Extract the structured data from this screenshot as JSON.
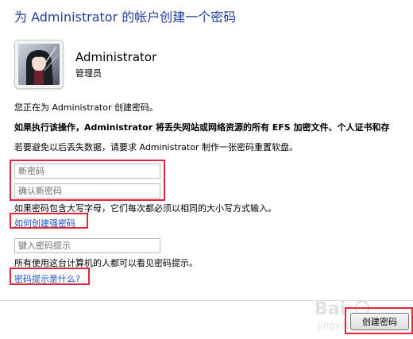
{
  "page": {
    "title": "为 Administrator 的帐户创建一个密码"
  },
  "account": {
    "name": "Administrator",
    "role": "管理员"
  },
  "info": {
    "line1": "您正在为 Administrator 创建密码。",
    "warning": "如果执行该操作，Administrator 将丢失网站或网络资源的所有 EFS 加密文件、个人证书和存",
    "line3": "若要避免以后丢失数据，请要求 Administrator 制作一张密码重置软盘。"
  },
  "fields": {
    "new_password_placeholder": "新密码",
    "confirm_password_placeholder": "确认新密码",
    "hint_placeholder": "键入密码提示"
  },
  "case_note": "如果密码包含大写字母，它们每次都必须以相同的大小写方式输入。",
  "links": {
    "strong_password": "如何创建强密码",
    "what_is_hint": "密码提示是什么?"
  },
  "hint_note": "所有使用这台计算机的人都可以看见密码提示。",
  "buttons": {
    "create": "创建密码"
  },
  "watermark": {
    "brand": "Bai",
    "sub": "jingyan"
  },
  "colors": {
    "title": "#1e3f9e",
    "link": "#1a53c4",
    "highlight": "#e8243a"
  }
}
